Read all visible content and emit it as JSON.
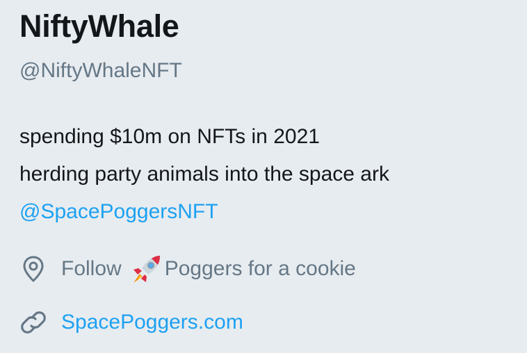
{
  "profile": {
    "display_name": "NiftyWhale",
    "handle": "@NiftyWhaleNFT",
    "bio": {
      "line1": "spending $10m on NFTs in 2021",
      "line2": "herding party animals into the space ark",
      "mention": "@SpacePoggersNFT"
    },
    "location": {
      "icon": "location-pin-icon",
      "text_before": "Follow",
      "emoji": "rocket-emoji",
      "text_after": "Poggers for a cookie"
    },
    "website": {
      "icon": "link-icon",
      "text": "SpacePoggers.com"
    }
  },
  "colors": {
    "background": "#e7ecf0",
    "text": "#14171a",
    "muted": "#657786",
    "link": "#1da1f2"
  }
}
